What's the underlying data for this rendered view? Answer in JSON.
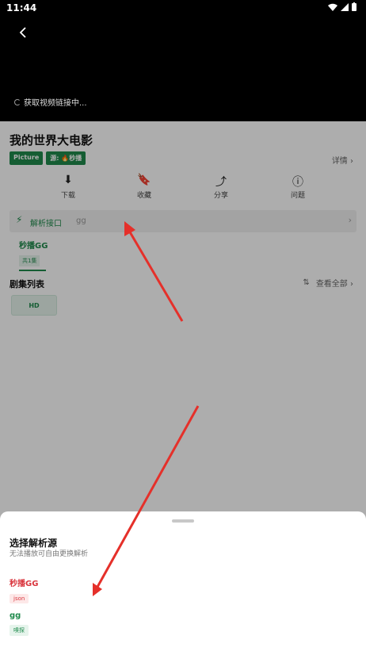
{
  "status_bar": {
    "time": "11:44"
  },
  "video": {
    "loading_text": "获取视频链接中..."
  },
  "movie": {
    "title": "我的世界大电影",
    "tags": [
      "Picture",
      "源: 🔥秒播"
    ],
    "details_label": "详情 ›"
  },
  "actions": [
    {
      "label": "下载",
      "icon": "download-icon"
    },
    {
      "label": "收藏",
      "icon": "bookmark-icon"
    },
    {
      "label": "分享",
      "icon": "share-icon"
    },
    {
      "label": "问题",
      "icon": "warning-icon"
    }
  ],
  "parse": {
    "label": "解析接口",
    "value": "gg"
  },
  "source_tab": {
    "name": "秒播GG",
    "count": "共1集"
  },
  "episodes": {
    "title": "剧集列表",
    "view_all": "查看全部 ›",
    "items": [
      "HD"
    ]
  },
  "sheet": {
    "title": "选择解析源",
    "subtitle": "无法播放可自由更换解析",
    "options": [
      {
        "name": "秒播GG",
        "badge": "json"
      },
      {
        "name": "gg",
        "badge": "嗅探"
      }
    ]
  },
  "colors": {
    "accent": "#1f8a4c",
    "danger": "#d9363e"
  }
}
